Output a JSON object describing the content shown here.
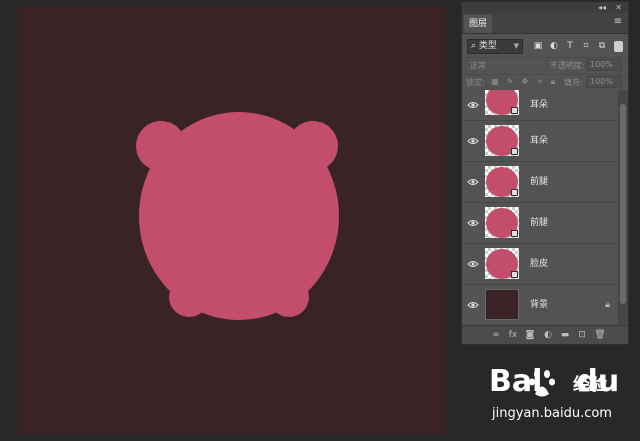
{
  "app": {
    "name": "Photoshop"
  },
  "canvas": {
    "background_color": "#3a2326",
    "shape_color": "#c24e6c"
  },
  "layers_panel": {
    "tab_label": "图层",
    "filter": {
      "selected": "类型",
      "search_icon": "search-icon"
    },
    "blend_mode": "正常",
    "opacity_label": "不透明度:",
    "opacity_value": "100%",
    "lock_label": "锁定:",
    "fill_label": "填充:",
    "fill_value": "100%",
    "layers": [
      {
        "name": "耳朵",
        "visible": true,
        "type": "smart-object"
      },
      {
        "name": "耳朵",
        "visible": true,
        "type": "smart-object"
      },
      {
        "name": "前腿",
        "visible": true,
        "type": "smart-object"
      },
      {
        "name": "前腿",
        "visible": true,
        "type": "smart-object"
      },
      {
        "name": "脸皮",
        "visible": true,
        "type": "smart-object"
      },
      {
        "name": "背景",
        "visible": true,
        "type": "background",
        "locked": true
      }
    ],
    "footer_tools": [
      "link-icon",
      "fx-icon",
      "mask-icon",
      "adjustment-icon",
      "folder-icon",
      "new-layer-icon",
      "trash-icon"
    ]
  },
  "watermark": {
    "brand_left": "Bai",
    "brand_right": "du",
    "chinese": "经验",
    "url": "jingyan.baidu.com"
  }
}
